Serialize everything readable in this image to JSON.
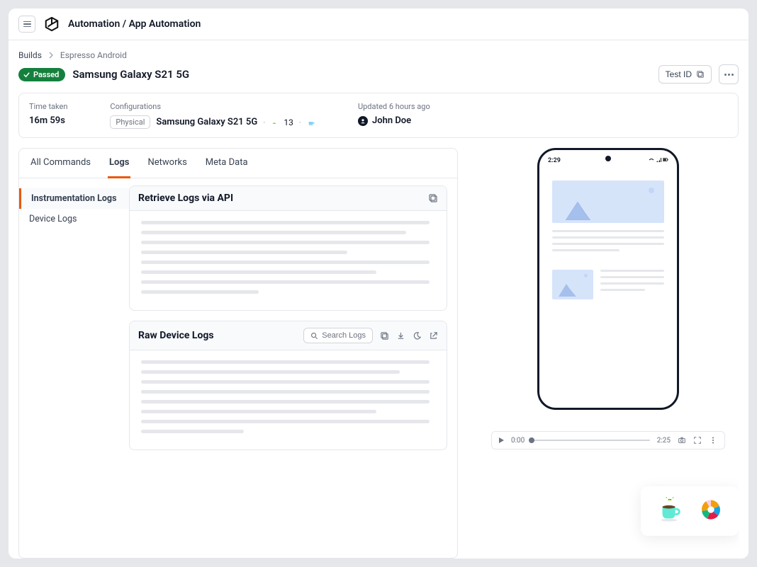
{
  "header": {
    "breadcrumb_root": "Automation",
    "breadcrumb_sep": " / ",
    "breadcrumb_leaf": "App Automation"
  },
  "crumbs": {
    "root": "Builds",
    "leaf": "Espresso Android"
  },
  "titlebar": {
    "status": "Passed",
    "title": "Samsung Galaxy S21 5G",
    "test_id_btn": "Test ID"
  },
  "meta": {
    "time_label": "Time taken",
    "time_value": "16m 59s",
    "config_label": "Configurations",
    "config_chip": "Physical",
    "config_device": "Samsung Galaxy S21 5G",
    "config_os": "13",
    "updated_label": "Updated 6 hours ago",
    "user_name": "John Doe"
  },
  "tabs": {
    "all": "All Commands",
    "logs": "Logs",
    "networks": "Networks",
    "meta": "Meta Data"
  },
  "side": {
    "instr": "Instrumentation Logs",
    "device": "Device Logs"
  },
  "cards": {
    "api_title": "Retrieve Logs via API",
    "raw_title": "Raw Device Logs",
    "search_label": "Search Logs"
  },
  "phone": {
    "time": "2:29"
  },
  "player": {
    "current": "0:00",
    "total": "2:25"
  }
}
